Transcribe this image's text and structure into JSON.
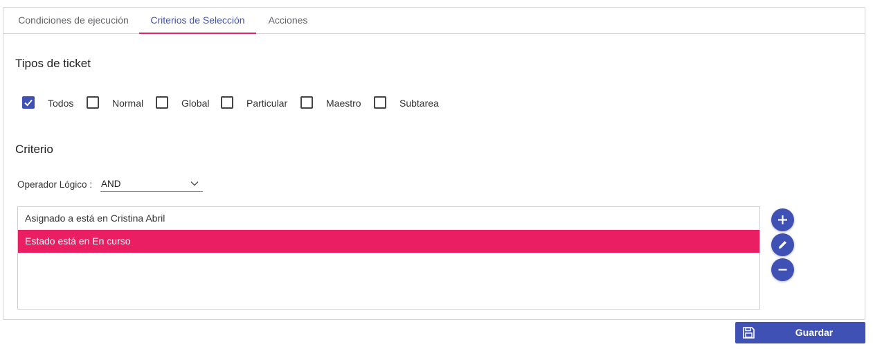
{
  "tabs": [
    {
      "label": "Condiciones de ejecución",
      "active": false
    },
    {
      "label": "Criterios de Selección",
      "active": true
    },
    {
      "label": "Acciones",
      "active": false
    }
  ],
  "ticket_types": {
    "title": "Tipos de ticket",
    "options": [
      {
        "label": "Todos",
        "checked": true
      },
      {
        "label": "Normal",
        "checked": false
      },
      {
        "label": "Global",
        "checked": false
      },
      {
        "label": "Particular",
        "checked": false
      },
      {
        "label": "Maestro",
        "checked": false
      },
      {
        "label": "Subtarea",
        "checked": false
      }
    ]
  },
  "criteria": {
    "title": "Criterio",
    "operator_label": "Operador Lógico :",
    "operator_value": "AND",
    "items": [
      {
        "text": "Asignado a está en Cristina Abril",
        "selected": false
      },
      {
        "text": "Estado está en En curso",
        "selected": true
      }
    ],
    "actions": [
      "add-icon",
      "edit-icon",
      "remove-icon"
    ]
  },
  "save_button": {
    "label": "Guardar",
    "icon": "save-icon"
  },
  "colors": {
    "primary": "#3f51b5",
    "accent": "#e91e63"
  }
}
